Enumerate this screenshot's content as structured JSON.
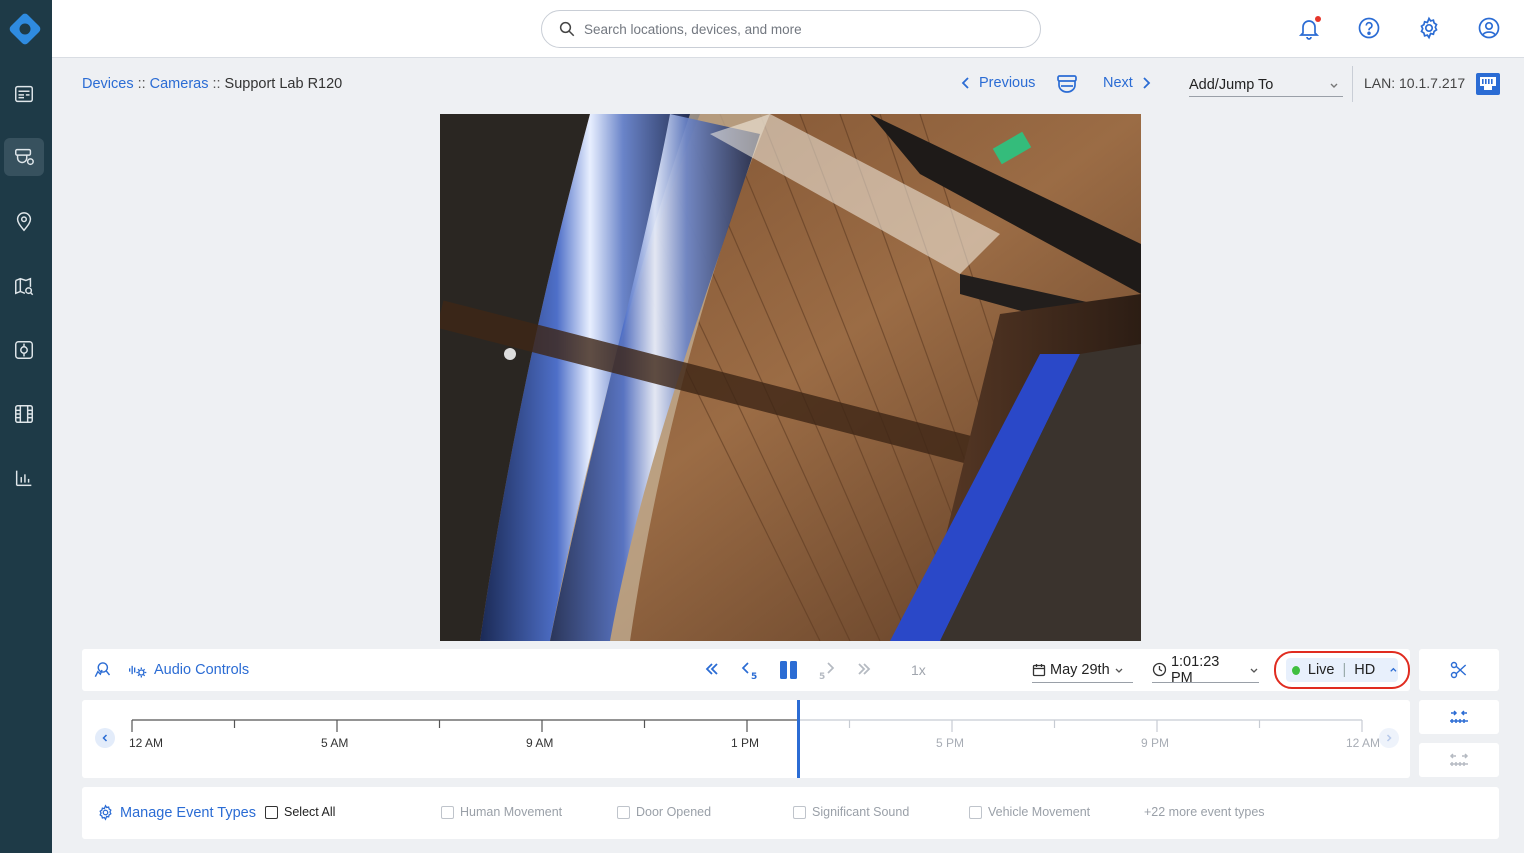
{
  "sidebar": {
    "items": [
      {
        "name": "dashboard-icon",
        "active": false
      },
      {
        "name": "devices-icon",
        "active": true
      },
      {
        "name": "location-pin-icon",
        "active": false
      },
      {
        "name": "map-search-icon",
        "active": false
      },
      {
        "name": "access-control-icon",
        "active": false
      },
      {
        "name": "film-icon",
        "active": false
      },
      {
        "name": "bar-chart-icon",
        "active": false
      }
    ]
  },
  "search": {
    "placeholder": "Search locations, devices, and more"
  },
  "breadcrumb": {
    "devices": "Devices",
    "cameras": "Cameras",
    "current": "Support Lab R120",
    "separator": "::"
  },
  "nav": {
    "previous": "Previous",
    "next": "Next"
  },
  "jump": {
    "label": "Add/Jump To"
  },
  "lan": {
    "text": "LAN: 10.1.7.217"
  },
  "controls": {
    "audio_label": "Audio Controls",
    "speed": "1x",
    "date": "May 29th",
    "time": "1:01:23 PM",
    "live": "Live",
    "quality": "HD"
  },
  "timeline": {
    "labels": [
      "12 AM",
      "5 AM",
      "9 AM",
      "1 PM",
      "5 PM",
      "9 PM",
      "12 AM"
    ],
    "playhead_fraction": 0.542
  },
  "events": {
    "manage": "Manage Event Types",
    "select_all": "Select All",
    "types": [
      "Human Movement",
      "Door Opened",
      "Significant Sound",
      "Vehicle Movement"
    ],
    "more": "+22 more event types"
  },
  "colors": {
    "accent": "#2b6cd4",
    "sidebar": "#1e3a47",
    "live_dot": "#3fbf3f",
    "highlight": "#e02c20"
  }
}
